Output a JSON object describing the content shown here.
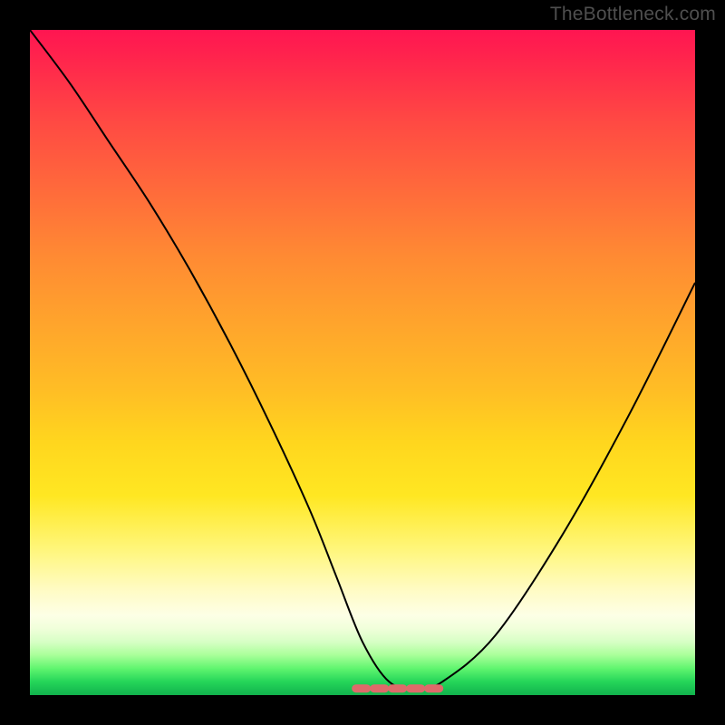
{
  "watermark": "TheBottleneck.com",
  "chart_data": {
    "type": "line",
    "title": "",
    "xlabel": "",
    "ylabel": "",
    "xlim": [
      0,
      100
    ],
    "ylim": [
      0,
      100
    ],
    "series": [
      {
        "name": "black-curve",
        "x": [
          0,
          6,
          12,
          18,
          24,
          30,
          36,
          42,
          46,
          50,
          54,
          58,
          62,
          70,
          80,
          90,
          100
        ],
        "y": [
          100,
          92,
          83,
          74,
          64,
          53,
          41,
          28,
          18,
          8,
          2,
          1,
          2,
          9,
          24,
          42,
          62
        ]
      },
      {
        "name": "flat-bottom-dash",
        "x": [
          49,
          62
        ],
        "y": [
          1,
          1
        ]
      }
    ]
  }
}
